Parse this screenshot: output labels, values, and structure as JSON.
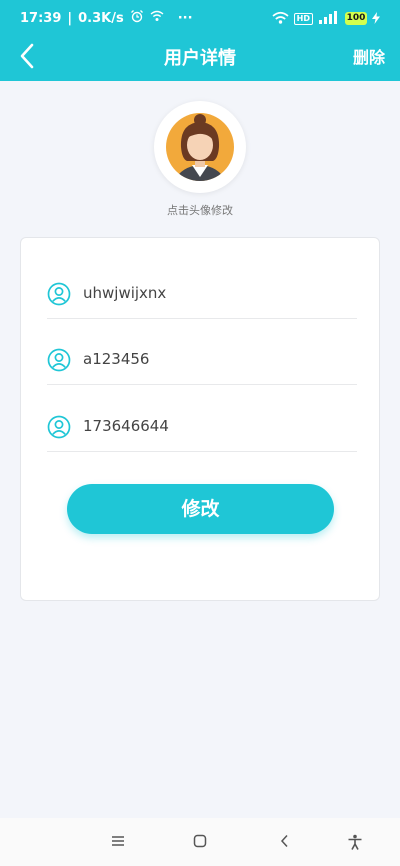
{
  "status_bar": {
    "time": "17:39",
    "speed": "0.3K/s",
    "more": "···",
    "hd_badge": "HD",
    "battery": "100"
  },
  "header": {
    "title": "用户详情",
    "delete_label": "删除"
  },
  "avatar": {
    "hint": "点击头像修改"
  },
  "form": {
    "fields": [
      {
        "value": "uhwjwijxnx"
      },
      {
        "value": "a123456"
      },
      {
        "value": "173646644"
      }
    ],
    "submit_label": "修改"
  },
  "colors": {
    "accent": "#1fc6d6",
    "background": "#f3f5fa"
  }
}
